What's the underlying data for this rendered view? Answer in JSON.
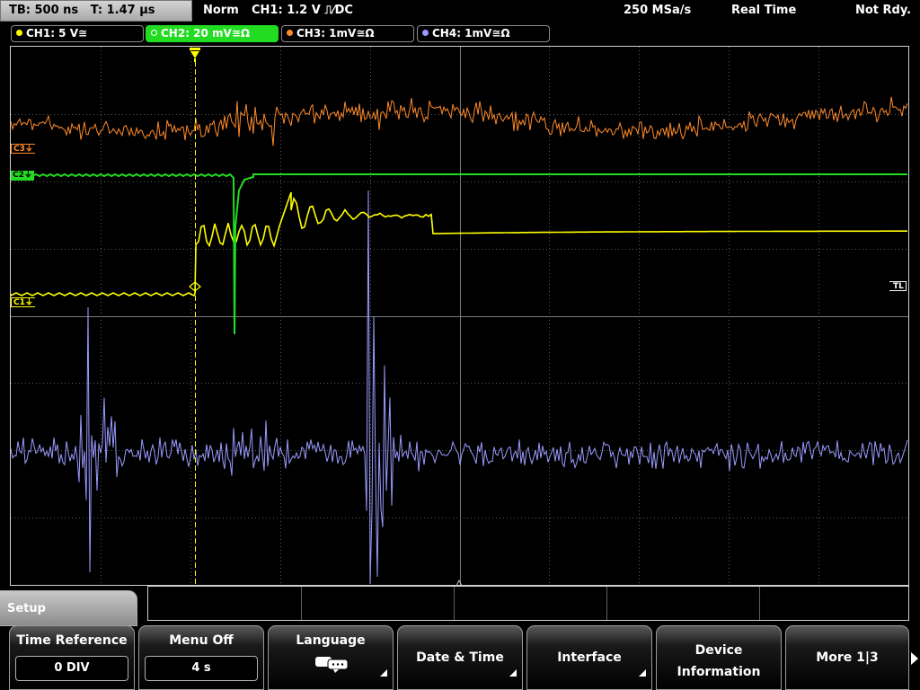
{
  "header": {
    "timebase": "TB: 500 ns   T: 1.47 µs",
    "trigger_mode": "Norm",
    "trigger_info": "CH1: 1.2 V ⎍⁄DC",
    "sample_rate": "250 MSa/s",
    "acq_mode": "Real Time",
    "status": "Not Rdy."
  },
  "channels": [
    {
      "label": "CH1: 5 V≅",
      "color": "#ffff00",
      "active": false
    },
    {
      "label": "CH2: 20 mV≅Ω",
      "color": "#22dc22",
      "active": true
    },
    {
      "label": "CH3: 1mV≅Ω",
      "color": "#ff8a2a",
      "active": false
    },
    {
      "label": "CH4: 1mV≅Ω",
      "color": "#9a9aff",
      "active": false
    }
  ],
  "markers": {
    "c3": "C3⏚",
    "c2": "C2⏚",
    "c1": "C1⏚",
    "trigger_level": "TL",
    "trigger_position": "T"
  },
  "menu": {
    "title": "Setup",
    "softkeys": [
      {
        "label": "Time Reference",
        "value": "0 DIV"
      },
      {
        "label": "Menu Off",
        "value": "4 s"
      },
      {
        "label": "Language"
      },
      {
        "label": "Date & Time"
      },
      {
        "label": "Interface"
      },
      {
        "label": "Device Information"
      },
      {
        "label": "More 1|3"
      }
    ]
  },
  "colors": {
    "ch1": "#ffff00",
    "ch2": "#22dc22",
    "ch3": "#ff8a2a",
    "ch4": "#9a9aff",
    "grid": "#5a5a5a"
  }
}
